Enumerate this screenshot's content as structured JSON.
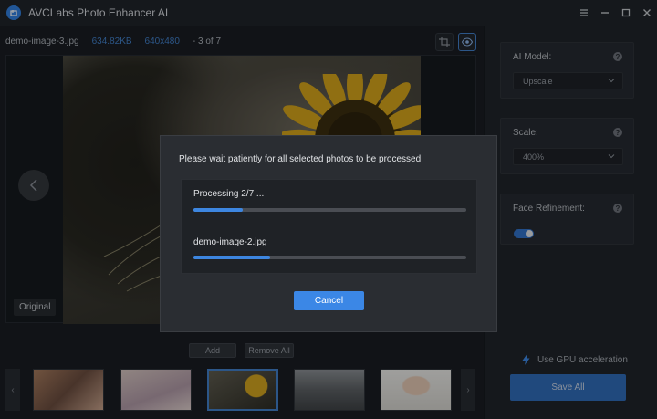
{
  "app": {
    "title": "AVCLabs Photo Enhancer AI"
  },
  "window_controls": [
    "menu-icon",
    "minimize-icon",
    "maximize-icon",
    "close-icon"
  ],
  "file_info": {
    "name": "demo-image-3.jpg",
    "size": "634.82KB",
    "dimensions": "640x480",
    "position": "- 3 of 7"
  },
  "viewer": {
    "original_label": "Original"
  },
  "thumb_actions": {
    "add": "Add",
    "remove_all": "Remove All"
  },
  "thumbnails": [
    {
      "name": "group-photo-thumb"
    },
    {
      "name": "anime-girl-thumb"
    },
    {
      "name": "sunflower-thumb",
      "active": true
    },
    {
      "name": "city-street-thumb"
    },
    {
      "name": "portrait-thumb"
    }
  ],
  "sidebar": {
    "ai_model": {
      "label": "AI Model:",
      "value": "Upscale"
    },
    "scale": {
      "label": "Scale:",
      "value": "400%"
    },
    "face_refinement": {
      "label": "Face Refinement:",
      "enabled": true
    },
    "gpu": {
      "label": "Use GPU acceleration"
    },
    "save_all": "Save All"
  },
  "dialog": {
    "message": "Please wait patiently for all selected photos to be processed",
    "overall": {
      "label": "Processing 2/7 ...",
      "progress": 0.18
    },
    "current": {
      "label": "demo-image-2.jpg",
      "progress": 0.28
    },
    "cancel": "Cancel"
  },
  "colors": {
    "accent": "#3b87e6",
    "panel": "#23262b",
    "background": "#16181c"
  }
}
